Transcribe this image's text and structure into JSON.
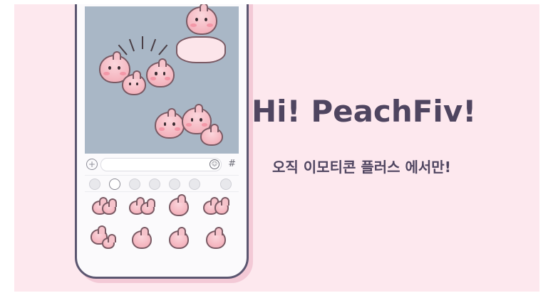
{
  "banner": {
    "title": "Hi! PeachFiv!",
    "subtitle": "오직 이모티콘 플러스 에서만!"
  },
  "colors": {
    "background": "#fde8ee",
    "text": "#4f4560",
    "phone_frame": "#5b5670",
    "chat_background": "#a9b7c6",
    "peach": "#f4b3bd"
  },
  "keyboard": {
    "plus_icon": "plus-icon",
    "plus_glyph": "+",
    "emoji_icon": "emoji-icon",
    "emoji_glyph": "☺",
    "hash_label": "#",
    "tabs": [
      "recent-icon",
      "chat-bubble-icon",
      "sticker-pack-1",
      "sticker-pack-2",
      "sticker-pack-3",
      "sticker-pack-4",
      "store-icon"
    ]
  }
}
